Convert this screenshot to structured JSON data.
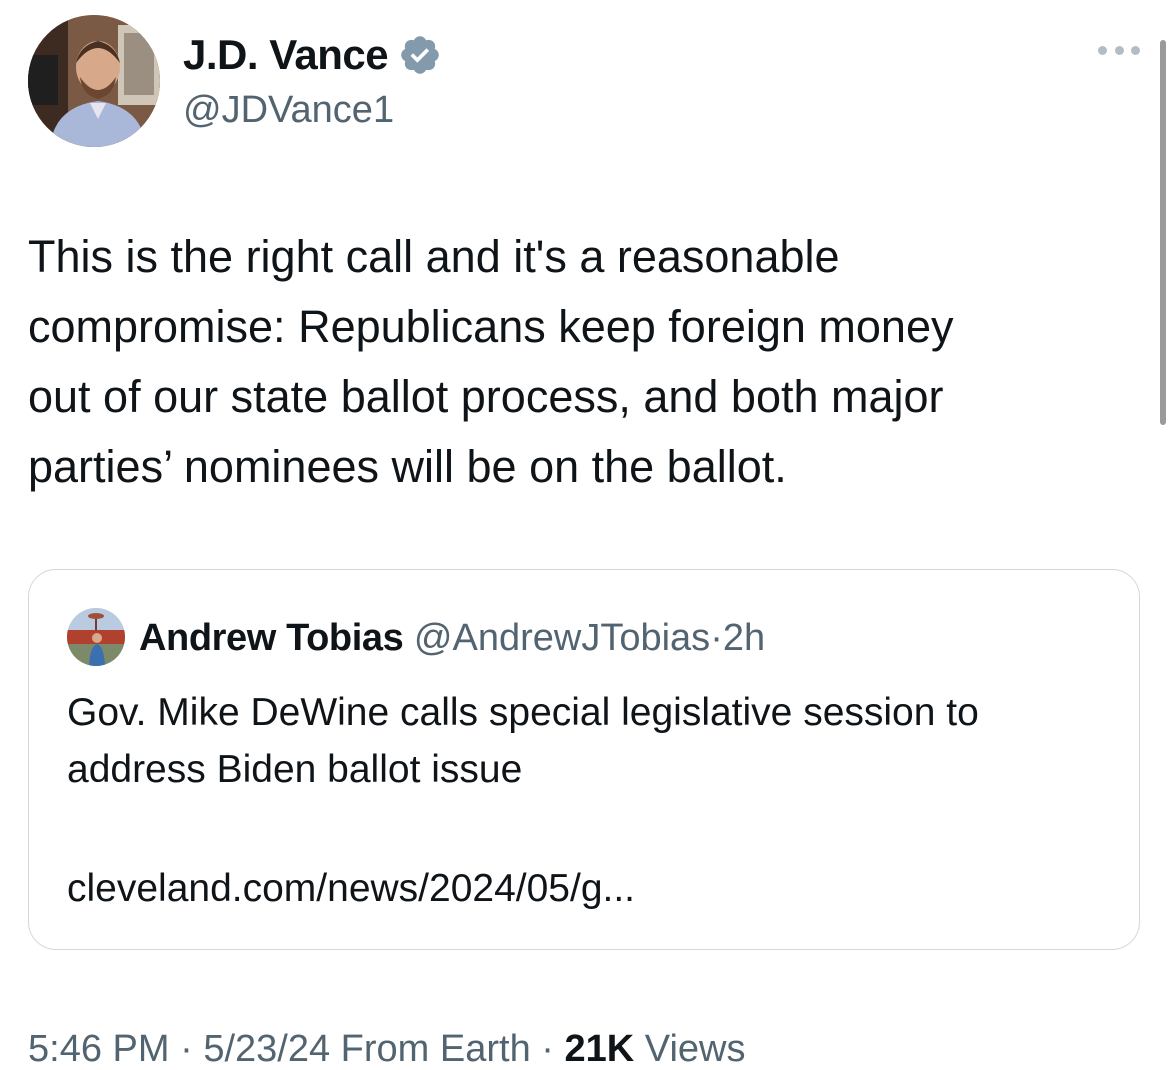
{
  "author": {
    "display_name": "J.D. Vance",
    "handle": "@JDVance1",
    "verified_badge_icon": "verified-badge-icon",
    "badge_color": "#829aab"
  },
  "menu": {
    "more_icon": "more-horizontal-icon"
  },
  "tweet": {
    "text": "This is the right call and it's a reasonable\ncompromise: Republicans keep foreign money\nout of our state ballot process, and both major\nparties’ nominees will be on the ballot."
  },
  "quote": {
    "display_name": "Andrew Tobias",
    "handle": "@AndrewJTobias",
    "separator": "·",
    "time_ago": "2h",
    "text": "Gov. Mike DeWine calls special legislative session to address Biden ballot issue",
    "link": "cleveland.com/news/2024/05/g..."
  },
  "meta": {
    "time": "5:46 PM",
    "separator": "·",
    "date": "5/23/24",
    "source": "From Earth",
    "views_count": "21K",
    "views_label": "Views"
  },
  "colors": {
    "text_primary": "#0f1419",
    "text_secondary": "#536471",
    "border": "#cfd9de"
  }
}
